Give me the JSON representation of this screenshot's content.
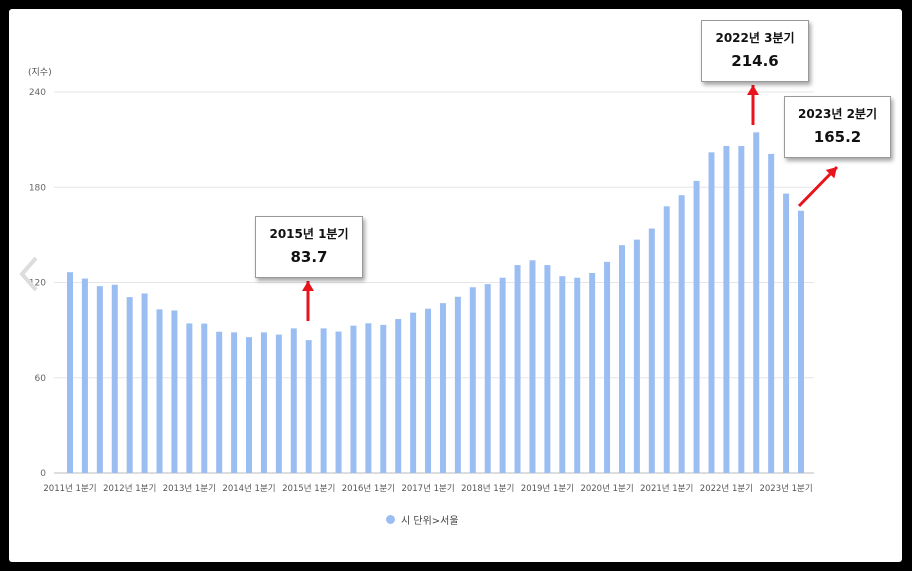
{
  "chart_data": {
    "type": "bar",
    "unit_label": "(지수)",
    "ylim": [
      0,
      240
    ],
    "yticks": [
      0,
      60,
      120,
      180,
      240
    ],
    "grid": true,
    "x_tick_labels": [
      "2011년 1분기",
      "2012년 1분기",
      "2013년 1분기",
      "2014년 1분기",
      "2015년 1분기",
      "2016년 1분기",
      "2017년 1분기",
      "2018년 1분기",
      "2019년 1분기",
      "2020년 1분기",
      "2021년 1분기",
      "2022년 1분기",
      "2023년 1분기"
    ],
    "color": "#9bbef2",
    "series": [
      {
        "name": "시 단위>서울",
        "values": [
          126.5,
          122.5,
          117.7,
          118.6,
          110.8,
          113.1,
          103.1,
          102.4,
          94.2,
          94.1,
          89.0,
          88.6,
          85.6,
          88.6,
          87.2,
          91.1,
          83.7,
          91.1,
          89.1,
          92.8,
          94.3,
          93.3,
          97.0,
          101.0,
          103.5,
          107.0,
          111.0,
          117.0,
          119.0,
          123.0,
          131.0,
          134.0,
          131.0,
          124.0,
          123.0,
          126.0,
          133.0,
          143.5,
          147.0,
          154.0,
          168.0,
          175.0,
          184.0,
          202.0,
          206.0,
          206.0,
          214.6,
          201.0,
          176.0,
          165.2
        ]
      }
    ],
    "annotations": [
      {
        "label": "2015년 1분기",
        "value": "83.7"
      },
      {
        "label": "2022년 3분기",
        "value": "214.6"
      },
      {
        "label": "2023년 2분기",
        "value": "165.2"
      }
    ]
  },
  "legend": {
    "label": "시 단위>서울"
  },
  "icons": {
    "nav": "chevron-left-icon"
  }
}
